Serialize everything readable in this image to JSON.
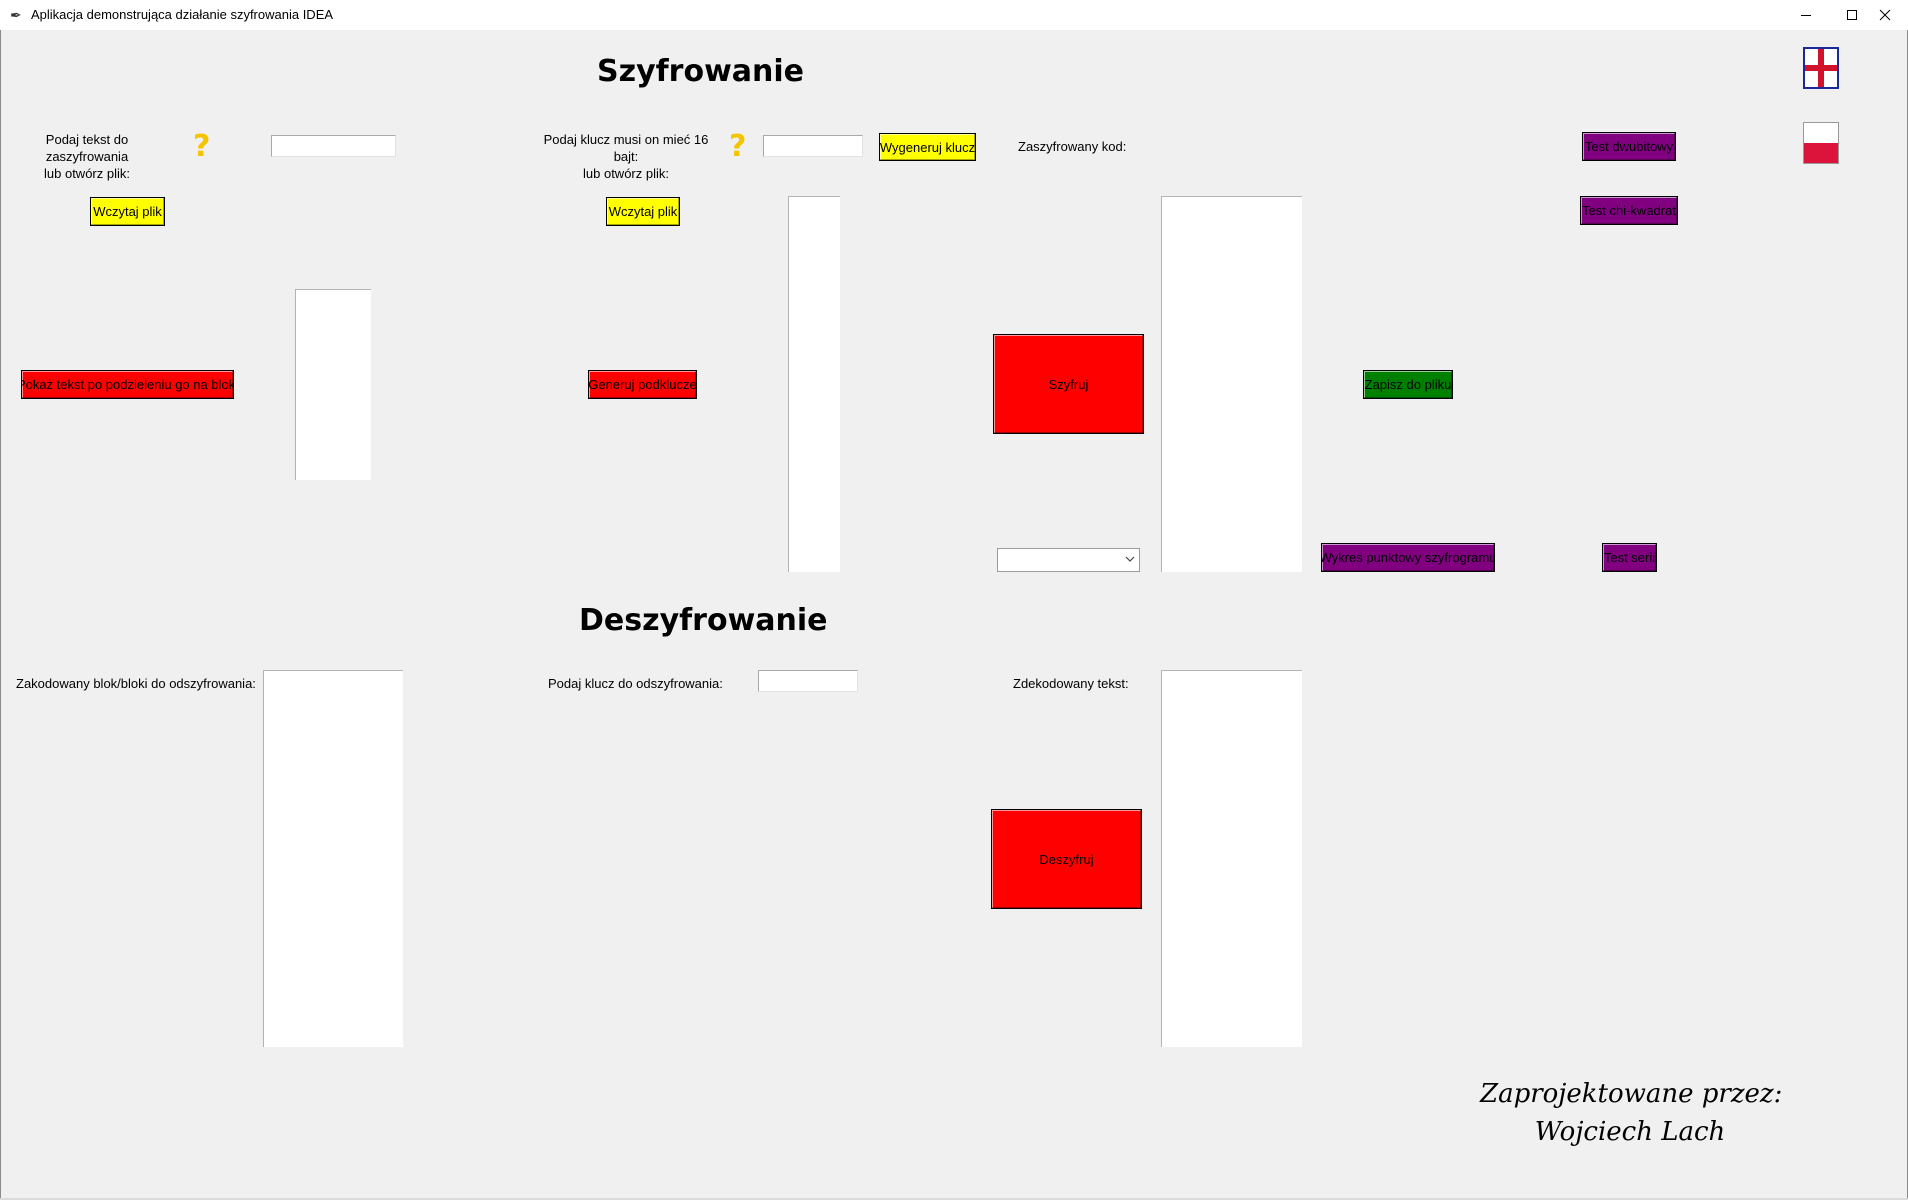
{
  "window": {
    "title": "Aplikacja demonstrująca działanie szyfrowania IDEA",
    "minimize_icon": "minimize-icon",
    "maximize_icon": "maximize-icon",
    "close_icon": "close-icon"
  },
  "languages": {
    "english_flag": "english-flag-icon",
    "polish_flag": "polish-flag-icon"
  },
  "encryption": {
    "heading": "Szyfrowanie",
    "plaintext_label": "Podaj tekst do zaszyfrowania\nlub otwórz plik:",
    "plaintext_help": "?",
    "plaintext_value": "",
    "load_file_1": "Wczytaj plik",
    "key_label": "Podaj klucz musi on mieć 16 bajt:\nlub otwórz plik:",
    "key_help": "?",
    "key_value": "",
    "generate_key": "Wygeneruj klucz",
    "load_file_2": "Wczytaj plik",
    "encrypted_code_label": "Zaszyfrowany kod:",
    "show_blocks": "Pokaż tekst po podzieleniu go na bloki",
    "generate_subkeys": "Generuj podklucze",
    "encrypt": "Szyfruj",
    "save_to_file": "Zapisz do pliku",
    "mode_select": "",
    "test_bit_pairs": "Test dwubitowy",
    "test_chi_square": "Test chi-kwadrat",
    "test_runs": "Test serii",
    "scatter_plot": "Wykres punktowy szyfrogramu"
  },
  "decryption": {
    "heading": "Deszyfrowanie",
    "encoded_blocks_label": "Zakodowany blok/bloki do odszyfrowania:",
    "key_label": "Podaj klucz do odszyfrowania:",
    "key_value": "",
    "decoded_text_label": "Zdekodowany tekst:",
    "decrypt": "Deszyfruj"
  },
  "footer": {
    "designed_by": "Zaprojektowane przez:",
    "author": "Wojciech Lach"
  },
  "colors": {
    "yellow_button": "#ffff00",
    "red_button": "#ff0000",
    "green_button": "#008000",
    "purple_button": "#800080",
    "help_icon": "#f5c400"
  }
}
